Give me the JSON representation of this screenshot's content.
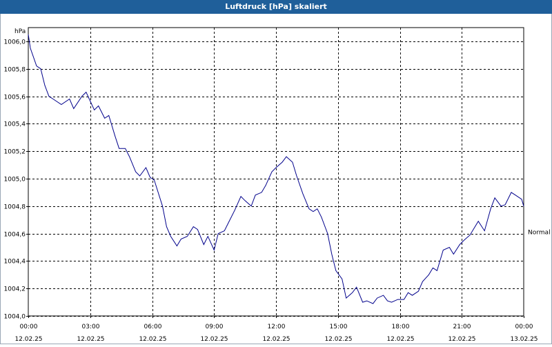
{
  "window": {
    "title": "Luftdruck [hPa] skaliert"
  },
  "colors": {
    "title_bar": "#1f5f9a",
    "series": "#00008b",
    "grid": "#000000"
  },
  "chart_data": {
    "type": "line",
    "title": "Luftdruck [hPa] skaliert",
    "ylabel": "hPa",
    "xlabel": "",
    "ylim": [
      1004.0,
      1006.1
    ],
    "xlim_hours": [
      0,
      24
    ],
    "grid": true,
    "y_ticks": [
      "1004,0",
      "1004,2",
      "1004,4",
      "1004,6",
      "1004,8",
      "1005,0",
      "1005,2",
      "1005,4",
      "1005,6",
      "1005,8",
      "1006,0"
    ],
    "y_tick_values": [
      1004.0,
      1004.2,
      1004.4,
      1004.6,
      1004.8,
      1005.0,
      1005.2,
      1005.4,
      1005.6,
      1005.8,
      1006.0
    ],
    "x_ticks": [
      {
        "hour": 0,
        "time": "00:00",
        "date": "12.02.25"
      },
      {
        "hour": 3,
        "time": "03:00",
        "date": "12.02.25"
      },
      {
        "hour": 6,
        "time": "06:00",
        "date": "12.02.25"
      },
      {
        "hour": 9,
        "time": "09:00",
        "date": "12.02.25"
      },
      {
        "hour": 12,
        "time": "12:00",
        "date": "12.02.25"
      },
      {
        "hour": 15,
        "time": "15:00",
        "date": "12.02.25"
      },
      {
        "hour": 18,
        "time": "18:00",
        "date": "12.02.25"
      },
      {
        "hour": 21,
        "time": "21:00",
        "date": "12.02.25"
      },
      {
        "hour": 24,
        "time": "00:00",
        "date": "13.02.25"
      }
    ],
    "annotations": [
      {
        "text": "Normal",
        "y": 1004.61
      }
    ],
    "series": [
      {
        "x": [
          0,
          0.1,
          0.4,
          0.6,
          0.8,
          1,
          1.2,
          1.6,
          2,
          2.2,
          2.6,
          2.8,
          3.2,
          3.4,
          3.7,
          3.9,
          4.2,
          4.4,
          4.7,
          4.9,
          5.2,
          5.4,
          5.7,
          5.9,
          6.1,
          6.5,
          6.7,
          6.9,
          7.2,
          7.4,
          7.7,
          8,
          8.2,
          8.5,
          8.7,
          9,
          9.2,
          9.5,
          9.7,
          10,
          10.3,
          10.5,
          10.8,
          11,
          11.3,
          11.5,
          11.8,
          12,
          12.3,
          12.5,
          12.8,
          13.0,
          13.3,
          13.6,
          13.8,
          14.0,
          14.2,
          14.5,
          14.7,
          14.9,
          15.2,
          15.4,
          15.7,
          15.9,
          16.2,
          16.4,
          16.7,
          16.9,
          17.2,
          17.4,
          17.6,
          17.9,
          18.2,
          18.4,
          18.6,
          18.9,
          19.1,
          19.4,
          19.6,
          19.8,
          20.1,
          20.4,
          20.6,
          20.9,
          21.1,
          21.4,
          21.6,
          21.8,
          22.1,
          22.4,
          22.6,
          22.9,
          23.1,
          23.4,
          23.6,
          23.9,
          24
        ],
        "values": [
          1006.05,
          1005.95,
          1005.82,
          1005.8,
          1005.68,
          1005.6,
          1005.58,
          1005.54,
          1005.58,
          1005.51,
          1005.6,
          1005.63,
          1005.5,
          1005.53,
          1005.44,
          1005.46,
          1005.31,
          1005.22,
          1005.22,
          1005.16,
          1005.05,
          1005.02,
          1005.08,
          1005.01,
          1004.99,
          1004.8,
          1004.65,
          1004.58,
          1004.51,
          1004.56,
          1004.58,
          1004.65,
          1004.63,
          1004.52,
          1004.58,
          1004.48,
          1004.6,
          1004.62,
          1004.68,
          1004.77,
          1004.87,
          1004.84,
          1004.8,
          1004.88,
          1004.9,
          1004.95,
          1005.05,
          1005.08,
          1005.12,
          1005.16,
          1005.12,
          1005.02,
          1004.89,
          1004.78,
          1004.76,
          1004.78,
          1004.72,
          1004.6,
          1004.45,
          1004.33,
          1004.27,
          1004.13,
          1004.17,
          1004.21,
          1004.1,
          1004.11,
          1004.09,
          1004.13,
          1004.15,
          1004.11,
          1004.1,
          1004.12,
          1004.12,
          1004.17,
          1004.15,
          1004.18,
          1004.25,
          1004.3,
          1004.35,
          1004.33,
          1004.48,
          1004.5,
          1004.45,
          1004.52,
          1004.55,
          1004.59,
          1004.64,
          1004.69,
          1004.62,
          1004.78,
          1004.86,
          1004.8,
          1004.81,
          1004.9,
          1004.88,
          1004.85,
          1004.8
        ]
      }
    ]
  }
}
